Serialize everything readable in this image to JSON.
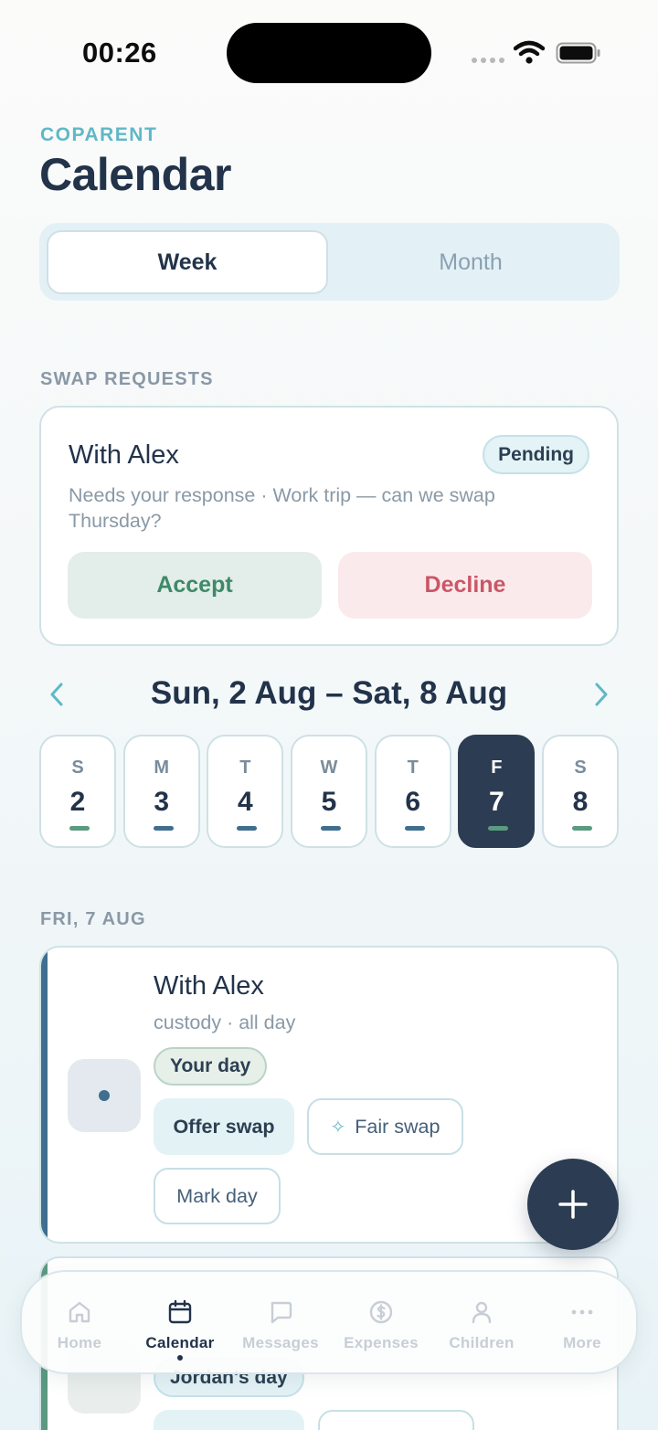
{
  "status_bar": {
    "time": "00:26"
  },
  "header": {
    "app_name": "COPARENT",
    "title": "Calendar"
  },
  "view_toggle": {
    "options": [
      "Week",
      "Month"
    ],
    "selected": "Week"
  },
  "swap_requests": {
    "section_label": "SWAP REQUESTS",
    "card": {
      "title": "With Alex",
      "badge": "Pending",
      "description": "Needs your response · Work trip — can we swap Thursday?",
      "accept_label": "Accept",
      "decline_label": "Decline"
    }
  },
  "week": {
    "range_label": "Sun, 2 Aug – Sat, 8 Aug",
    "days": [
      {
        "dow": "S",
        "num": "2"
      },
      {
        "dow": "M",
        "num": "3"
      },
      {
        "dow": "T",
        "num": "4"
      },
      {
        "dow": "W",
        "num": "5"
      },
      {
        "dow": "T",
        "num": "6"
      },
      {
        "dow": "F",
        "num": "7"
      },
      {
        "dow": "S",
        "num": "8"
      }
    ],
    "selected_day": "7"
  },
  "day_section": {
    "label": "FRI, 7 AUG",
    "event": {
      "title": "With Alex",
      "subtitle": "custody · all day",
      "tag": "Your day",
      "offer_swap_label": "Offer swap",
      "fair_swap_label": "Fair swap",
      "mark_day_label": "Mark day"
    },
    "event2": {
      "tag": "Jordan's day"
    }
  },
  "tab_bar": {
    "tabs": [
      {
        "label": "Home",
        "icon": "home-icon"
      },
      {
        "label": "Calendar",
        "icon": "calendar-icon"
      },
      {
        "label": "Messages",
        "icon": "message-icon"
      },
      {
        "label": "Expenses",
        "icon": "currency-icon"
      },
      {
        "label": "Children",
        "icon": "person-icon"
      },
      {
        "label": "More",
        "icon": "more-icon"
      }
    ],
    "active": "Calendar"
  },
  "colors": {
    "accent_teal": "#5fb8c7",
    "navy": "#2c3c52",
    "accept_green": "#3d8a68",
    "decline_red": "#c95766"
  }
}
